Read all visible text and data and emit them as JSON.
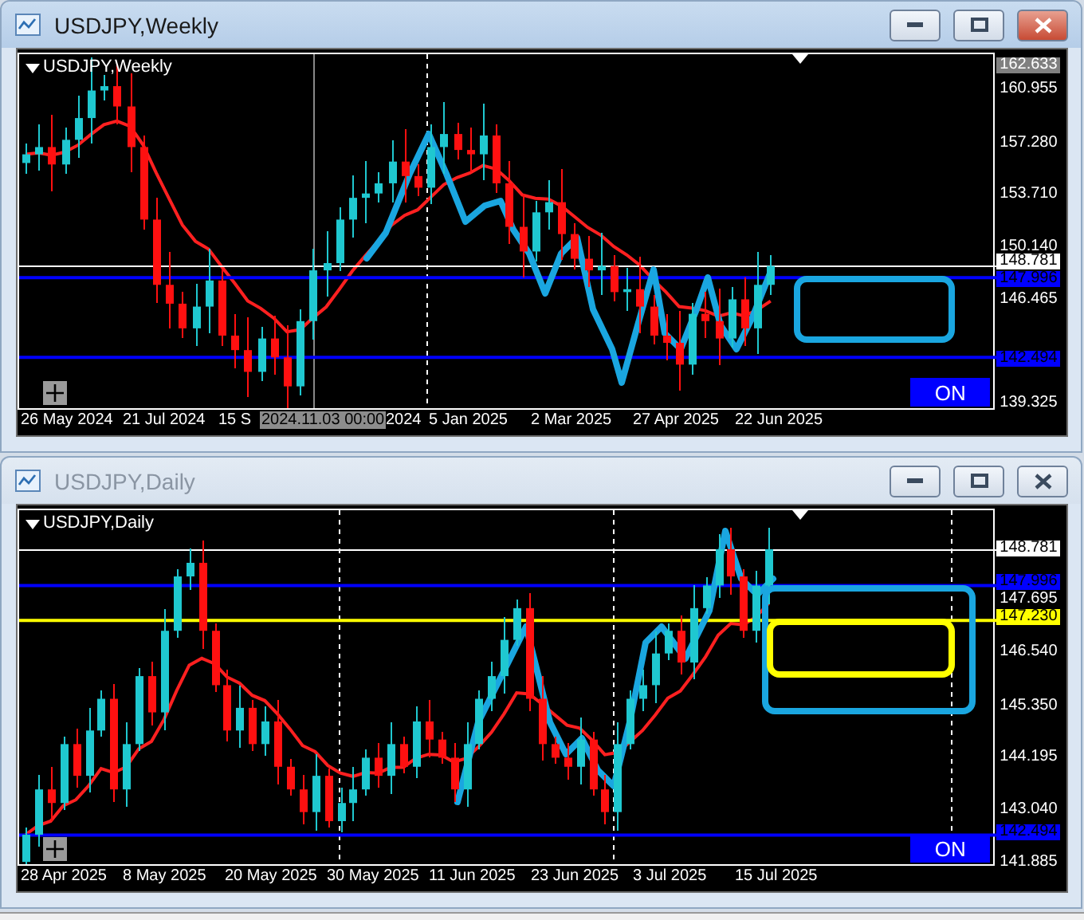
{
  "windows": [
    {
      "title": "USDJPY,Weekly",
      "active": true,
      "chart_label": "USDJPY,Weekly",
      "on_button": "ON",
      "price_labels": [
        {
          "text": "162.633",
          "kind": "top"
        },
        {
          "text": "160.955",
          "kind": "tick"
        },
        {
          "text": "157.280",
          "kind": "tick"
        },
        {
          "text": "153.710",
          "kind": "tick"
        },
        {
          "text": "150.140",
          "kind": "tick"
        },
        {
          "text": "148.781",
          "kind": "bid"
        },
        {
          "text": "147.996",
          "kind": "line",
          "color": "#0000ff"
        },
        {
          "text": "146.465",
          "kind": "tick"
        },
        {
          "text": "142.494",
          "kind": "line",
          "color": "#0000ff"
        },
        {
          "text": "139.325",
          "kind": "tick"
        }
      ],
      "dates": [
        "26 May 2024",
        "21 Jul 2024",
        "15 S",
        "2024",
        "5 Jan 2025",
        "2 Mar 2025",
        "27 Apr 2025",
        "22 Jun 2025"
      ],
      "crosshair_time": "2024.11.03 00:00"
    },
    {
      "title": "USDJPY,Daily",
      "active": false,
      "chart_label": "USDJPY,Daily",
      "on_button": "ON",
      "price_labels": [
        {
          "text": "148.781",
          "kind": "bid"
        },
        {
          "text": "147.996",
          "kind": "line",
          "color": "#0000ff"
        },
        {
          "text": "147.695",
          "kind": "tick"
        },
        {
          "text": "147.230",
          "kind": "line",
          "color": "#ffff00"
        },
        {
          "text": "146.540",
          "kind": "tick"
        },
        {
          "text": "145.350",
          "kind": "tick"
        },
        {
          "text": "144.195",
          "kind": "tick"
        },
        {
          "text": "143.040",
          "kind": "tick"
        },
        {
          "text": "142.494",
          "kind": "line",
          "color": "#0000ff"
        },
        {
          "text": "141.885",
          "kind": "tick"
        }
      ],
      "dates": [
        "28 Apr 2025",
        "8 May 2025",
        "20 May 2025",
        "30 May 2025",
        "11 Jun 2025",
        "23 Jun 2025",
        "3 Jul 2025",
        "15 Jul 2025"
      ]
    }
  ]
}
